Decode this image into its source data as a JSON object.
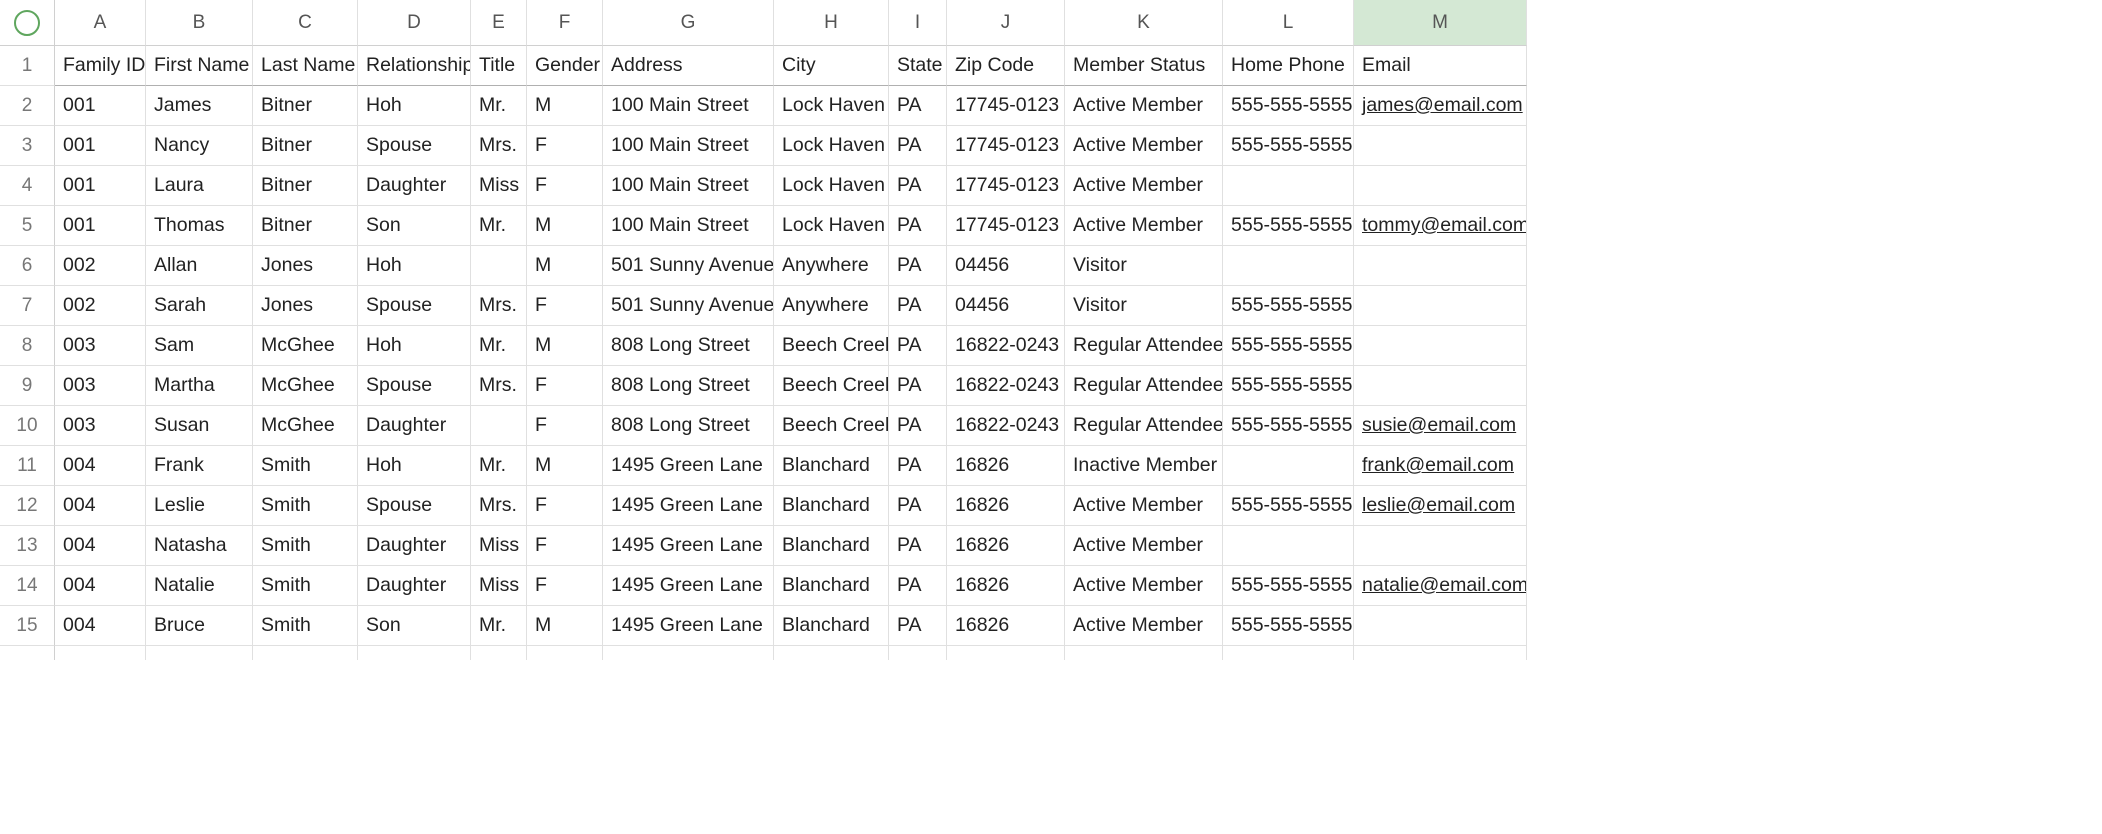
{
  "columns": [
    "A",
    "B",
    "C",
    "D",
    "E",
    "F",
    "G",
    "H",
    "I",
    "J",
    "K",
    "L",
    "M"
  ],
  "selectedColumnIndex": 12,
  "rowNumbers": [
    1,
    2,
    3,
    4,
    5,
    6,
    7,
    8,
    9,
    10,
    11,
    12,
    13,
    14,
    15
  ],
  "headers": [
    "Family ID",
    "First Name",
    "Last Name",
    "Relationship",
    "Title",
    "Gender",
    "Address",
    "City",
    "State",
    "Zip Code",
    "Member Status",
    "Home Phone",
    "Email"
  ],
  "rows": [
    [
      "001",
      "James",
      "Bitner",
      "Hoh",
      "Mr.",
      "M",
      "100 Main Street",
      "Lock Haven",
      "PA",
      "17745-0123",
      "Active Member",
      "555-555-5555",
      "james@email.com"
    ],
    [
      "001",
      "Nancy",
      "Bitner",
      "Spouse",
      "Mrs.",
      "F",
      "100 Main Street",
      "Lock Haven",
      "PA",
      "17745-0123",
      "Active Member",
      "555-555-5555",
      ""
    ],
    [
      "001",
      "Laura",
      "Bitner",
      "Daughter",
      "Miss",
      "F",
      "100 Main Street",
      "Lock Haven",
      "PA",
      "17745-0123",
      "Active Member",
      "",
      ""
    ],
    [
      "001",
      "Thomas",
      "Bitner",
      "Son",
      "Mr.",
      "M",
      "100 Main Street",
      "Lock Haven",
      "PA",
      "17745-0123",
      "Active Member",
      "555-555-5555",
      "tommy@email.com"
    ],
    [
      "002",
      "Allan",
      "Jones",
      "Hoh",
      "",
      "M",
      "501 Sunny Avenue",
      "Anywhere",
      "PA",
      "04456",
      "Visitor",
      "",
      ""
    ],
    [
      "002",
      "Sarah",
      "Jones",
      "Spouse",
      "Mrs.",
      "F",
      "501 Sunny Avenue",
      "Anywhere",
      "PA",
      "04456",
      "Visitor",
      "555-555-5555",
      ""
    ],
    [
      "003",
      "Sam",
      "McGhee",
      "Hoh",
      "Mr.",
      "M",
      "808 Long Street",
      "Beech Creek",
      "PA",
      "16822-0243",
      "Regular Attendee",
      "555-555-5555",
      ""
    ],
    [
      "003",
      "Martha",
      "McGhee",
      "Spouse",
      "Mrs.",
      "F",
      "808 Long Street",
      "Beech Creek",
      "PA",
      "16822-0243",
      "Regular Attendee",
      "555-555-5555",
      ""
    ],
    [
      "003",
      "Susan",
      "McGhee",
      "Daughter",
      "",
      "F",
      "808 Long Street",
      "Beech Creek",
      "PA",
      "16822-0243",
      "Regular Attendee",
      "555-555-5555",
      "susie@email.com"
    ],
    [
      "004",
      "Frank",
      "Smith",
      "Hoh",
      "Mr.",
      "M",
      "1495 Green Lane",
      "Blanchard",
      "PA",
      "16826",
      "Inactive Member",
      "",
      "frank@email.com"
    ],
    [
      "004",
      "Leslie",
      "Smith",
      "Spouse",
      "Mrs.",
      "F",
      "1495 Green Lane",
      "Blanchard",
      "PA",
      "16826",
      "Active Member",
      "555-555-5555",
      "leslie@email.com"
    ],
    [
      "004",
      "Natasha",
      "Smith",
      "Daughter",
      "Miss",
      "F",
      "1495 Green Lane",
      "Blanchard",
      "PA",
      "16826",
      "Active Member",
      "",
      ""
    ],
    [
      "004",
      "Natalie",
      "Smith",
      "Daughter",
      "Miss",
      "F",
      "1495 Green Lane",
      "Blanchard",
      "PA",
      "16826",
      "Active Member",
      "555-555-5555",
      "natalie@email.com"
    ],
    [
      "004",
      "Bruce",
      "Smith",
      "Son",
      "Mr.",
      "M",
      "1495 Green Lane",
      "Blanchard",
      "PA",
      "16826",
      "Active Member",
      "555-555-5555",
      ""
    ]
  ]
}
